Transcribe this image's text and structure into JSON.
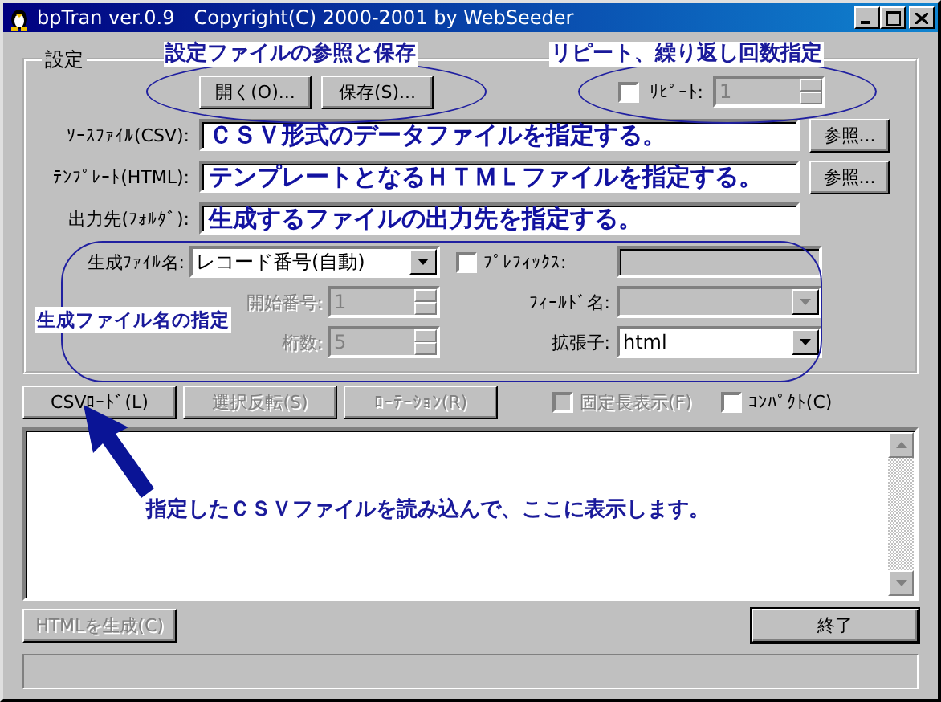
{
  "window": {
    "title": "bpTran ver.0.9　Copyright(C) 2000-2001 by WebSeeder"
  },
  "settings": {
    "group_label": "設定",
    "open_button": "開く(O)...",
    "save_button": "保存(S)...",
    "repeat": {
      "label": "ﾘﾋﾟｰﾄ:",
      "checked": false,
      "value": "1",
      "disabled": true
    },
    "fields": [
      {
        "label": "ｿｰｽﾌｧｲﾙ(CSV):",
        "value": "ＣＳＶ形式のデータファイルを指定する。",
        "browse": "参照..."
      },
      {
        "label": "ﾃﾝﾌﾟﾚｰﾄ(HTML):",
        "value": "テンプレートとなるＨＴＭＬファイルを指定する。",
        "browse": "参照..."
      },
      {
        "label": "出力先(ﾌｫﾙﾀﾞ):",
        "value": "生成するファイルの出力先を指定する。"
      }
    ],
    "filename": {
      "label": "生成ﾌｧｲﾙ名:",
      "value": "レコード番号(自動)"
    },
    "prefix": {
      "label": "ﾌﾟﾚﾌｨｯｸｽ:",
      "checked": false,
      "disabled": true
    },
    "start_number": {
      "label": "開始番号:",
      "value": "1",
      "disabled": true
    },
    "field_name": {
      "label": "ﾌｨｰﾙﾄﾞ名:",
      "disabled": true
    },
    "digits": {
      "label": "桁数:",
      "value": "5",
      "disabled": true
    },
    "extension": {
      "label": "拡張子:",
      "value": "html"
    }
  },
  "toolbar": {
    "buttons": [
      {
        "label": "CSVﾛｰﾄﾞ(L)",
        "disabled": false
      },
      {
        "label": "選択反転(S)",
        "disabled": true
      },
      {
        "label": "ﾛｰﾃｰｼｮﾝ(R)",
        "disabled": true
      }
    ],
    "checkboxes": [
      {
        "label": "固定長表示(F)",
        "checked": false,
        "disabled": true
      },
      {
        "label": "ｺﾝﾊﾟｸﾄ(C)",
        "checked": false,
        "disabled": false
      }
    ]
  },
  "footer": {
    "generate_button": {
      "label": "HTMLを生成(C)",
      "disabled": true
    },
    "exit_button": "終了"
  },
  "annotations": {
    "settings_file": "設定ファイルの参照と保存",
    "repeat": "リピート、繰り返し回数指定",
    "filename": "生成ファイル名の指定",
    "list": "指定したＣＳＶファイルを読み込んで、ここに表示します。"
  }
}
